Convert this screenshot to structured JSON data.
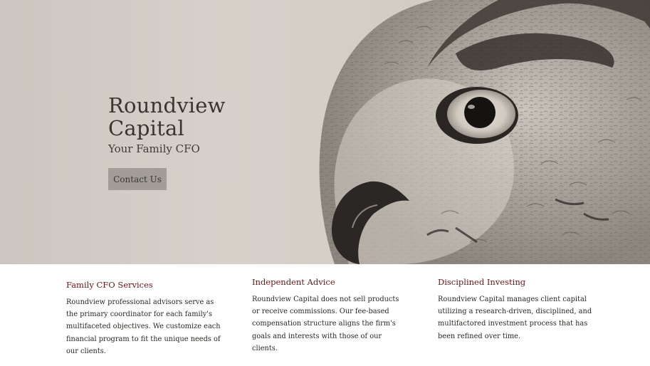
{
  "hero": {
    "title": "Roundview Capital",
    "subtitle": "Your Family CFO",
    "cta_label": "Contact Us",
    "image_subject": "owl-icon"
  },
  "features": [
    {
      "title": "Family CFO Services",
      "body": "Roundview professional advisors serve as the primary coordinator for each family's multifaceted objectives. We customize each financial program to fit the unique needs of our clients."
    },
    {
      "title": "Independent Advice",
      "body": "Roundview Capital does not sell products or receive commissions. Our fee-based compensation structure aligns the firm's goals and interests with those of our clients."
    },
    {
      "title": "Disciplined Investing",
      "body": "Roundview Capital manages client capital utilizing a research-driven, disciplined, and multifactored investment process that has been refined over time."
    }
  ],
  "colors": {
    "heading_accent": "#6b1414",
    "button_bg": "#a29d97",
    "hero_bg": "#d3cec6"
  }
}
